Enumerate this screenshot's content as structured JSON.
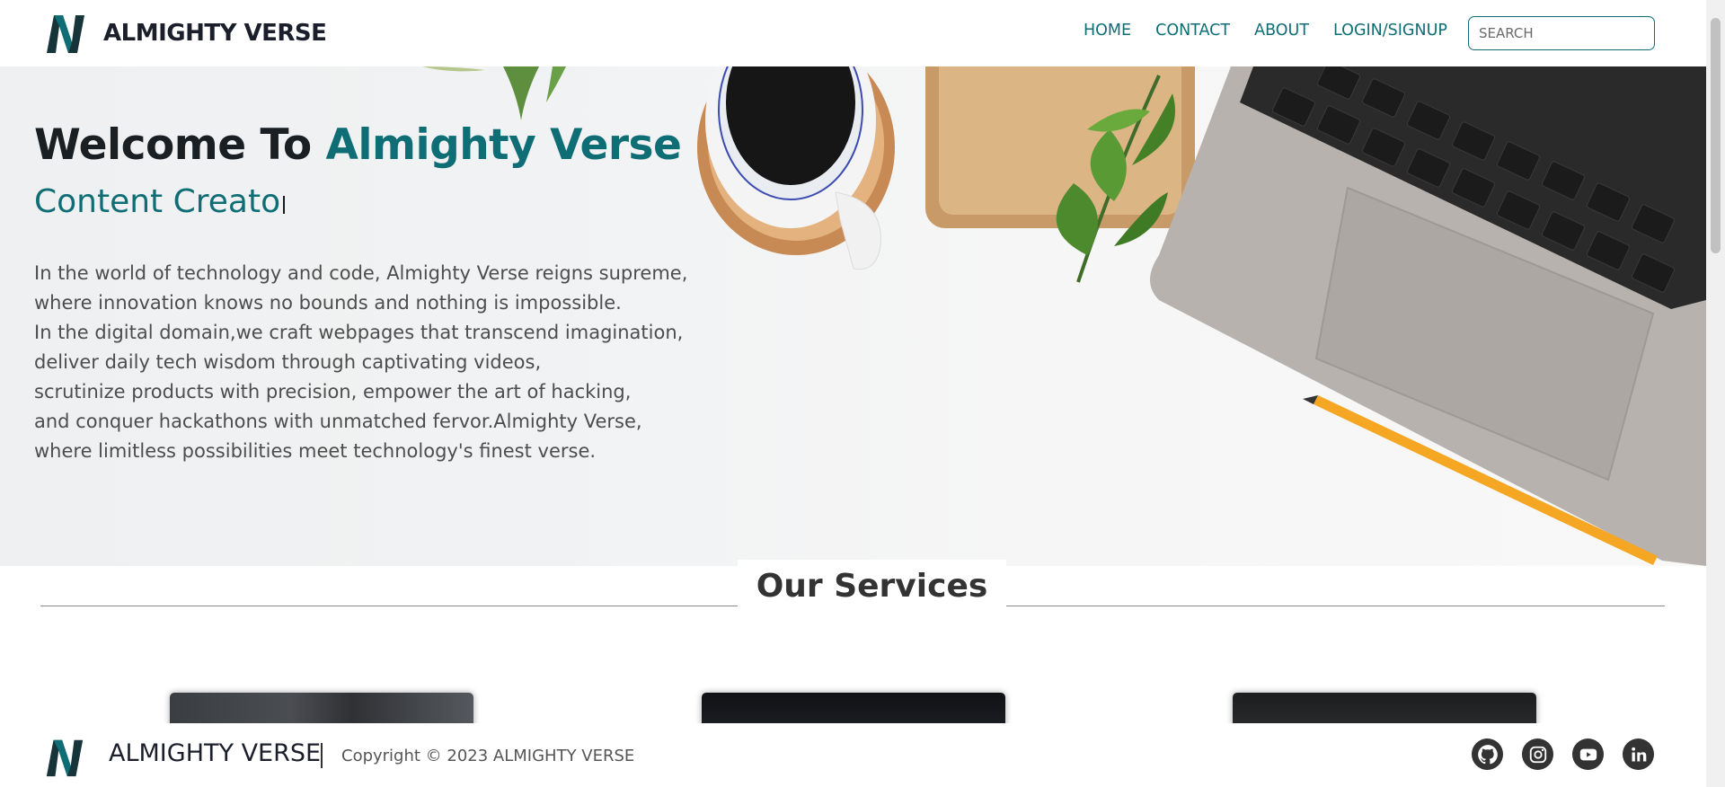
{
  "brand": {
    "name": "ALMIGHTY VERSE"
  },
  "nav": {
    "links": [
      "HOME",
      "CONTACT",
      "ABOUT",
      "LOGIN/SIGNUP"
    ],
    "search_placeholder": "SEARCH"
  },
  "hero": {
    "title_prefix": "Welcome To ",
    "title_accent": "Almighty Verse",
    "subtitle": "Content Creato",
    "description": [
      "In the world of technology and code, Almighty Verse reigns supreme,",
      "where innovation knows no bounds and nothing is impossible.",
      "In the digital domain,we craft webpages that transcend imagination,",
      "deliver daily tech wisdom through captivating videos,",
      "scrutinize products with precision, empower the art of hacking,",
      "and conquer hackathons with unmatched fervor.Almighty Verse,",
      "where limitless possibilities meet technology's finest verse."
    ]
  },
  "services": {
    "title": "Our Services"
  },
  "footer": {
    "brand": "ALMIGHTY VERSE",
    "copyright": "Copyright © 2023 ALMIGHTY VERSE",
    "socials": [
      "github-icon",
      "instagram-icon",
      "youtube-icon",
      "linkedin-icon"
    ]
  },
  "colors": {
    "accent": "#0f6e75",
    "text_dark": "#1a1f24",
    "text_body": "#4d4d4d"
  }
}
